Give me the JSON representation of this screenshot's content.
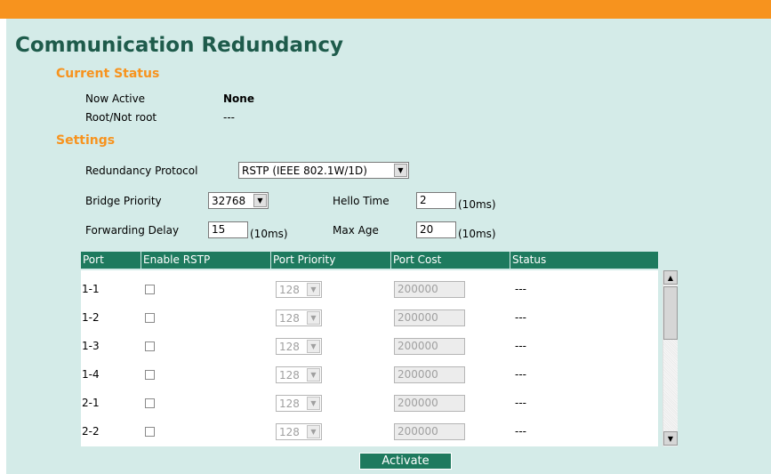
{
  "page": {
    "title": "Communication Redundancy",
    "colors": {
      "accent_bar": "#f7931e",
      "panel": "#d4ebe8",
      "title": "#1e5b4b",
      "section": "#f7931e",
      "table_header": "#1e7a5e"
    }
  },
  "current_status": {
    "heading": "Current Status",
    "now_active_label": "Now Active",
    "now_active_value": "None",
    "root_label": "Root/Not root",
    "root_value": "---"
  },
  "settings": {
    "heading": "Settings",
    "redundancy_protocol_label": "Redundancy Protocol",
    "redundancy_protocol_value": "RSTP (IEEE 802.1W/1D)",
    "bridge_priority_label": "Bridge Priority",
    "bridge_priority_value": "32768",
    "hello_time_label": "Hello Time",
    "hello_time_value": "2",
    "hello_time_unit": "(10ms)",
    "forwarding_delay_label": "Forwarding Delay",
    "forwarding_delay_value": "15",
    "forwarding_delay_unit": "(10ms)",
    "max_age_label": "Max Age",
    "max_age_value": "20",
    "max_age_unit": "(10ms)"
  },
  "table": {
    "headers": [
      "Port",
      "Enable RSTP",
      "Port Priority",
      "Port Cost",
      "Status"
    ],
    "rows": [
      {
        "port": "1-1",
        "enabled": false,
        "priority": "128",
        "cost": "200000",
        "status": "---"
      },
      {
        "port": "1-2",
        "enabled": false,
        "priority": "128",
        "cost": "200000",
        "status": "---"
      },
      {
        "port": "1-3",
        "enabled": false,
        "priority": "128",
        "cost": "200000",
        "status": "---"
      },
      {
        "port": "1-4",
        "enabled": false,
        "priority": "128",
        "cost": "200000",
        "status": "---"
      },
      {
        "port": "2-1",
        "enabled": false,
        "priority": "128",
        "cost": "200000",
        "status": "---"
      },
      {
        "port": "2-2",
        "enabled": false,
        "priority": "128",
        "cost": "200000",
        "status": "---"
      }
    ]
  },
  "actions": {
    "activate_label": "Activate"
  },
  "icons": {
    "dropdown": "chevron-down-icon",
    "scroll_up": "scroll-up-arrow-icon",
    "scroll_down": "scroll-down-arrow-icon"
  }
}
